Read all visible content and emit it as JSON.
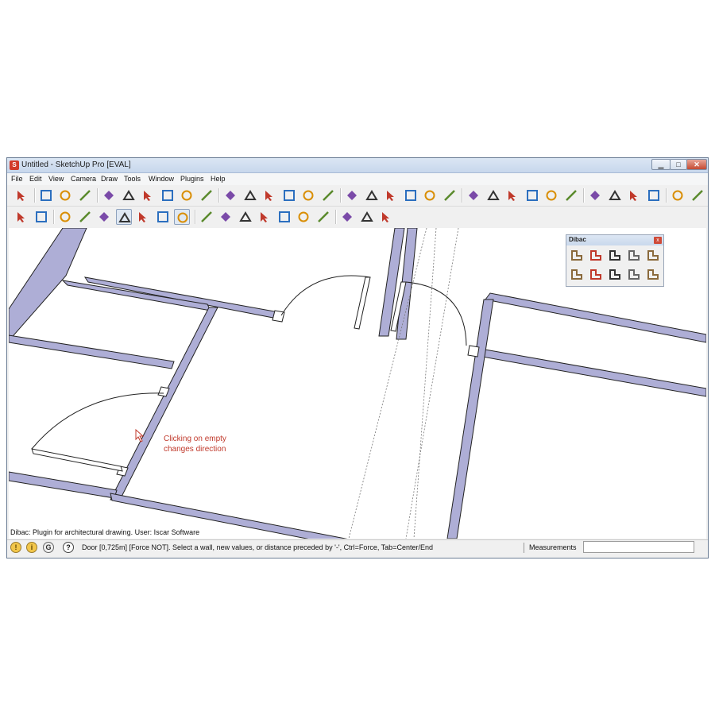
{
  "window": {
    "title": "Untitled - SketchUp Pro [EVAL]",
    "app_icon_letter": "S",
    "minimize_glyph": "▁",
    "maximize_glyph": "□",
    "close_glyph": "✕"
  },
  "menu": [
    "File",
    "Edit",
    "View",
    "Camera",
    "Draw",
    "Tools",
    "Window",
    "Plugins",
    "Help"
  ],
  "toolbar1": [
    "select",
    "make-component",
    "paint-bucket",
    "eraser",
    "rectangle",
    "line",
    "circle",
    "arc",
    "polygon",
    "freehand",
    "move",
    "push-pull",
    "rotate",
    "follow-me",
    "scale",
    "offset",
    "tape-measure",
    "dimension",
    "protractor",
    "text",
    "axes",
    "3d-text",
    "orbit",
    "pan",
    "zoom",
    "zoom-window",
    "zoom-extents",
    "previous-view",
    "position-camera",
    "look-around",
    "walk",
    "section-plane",
    "sandbox-1",
    "sandbox-2",
    "sandbox-3"
  ],
  "toolbar2": [
    "iso-view",
    "top-view",
    "xray",
    "back-edges",
    "wireframe",
    "hidden-line",
    "shaded",
    "shaded-textures",
    "monochrome",
    "iso",
    "top",
    "front",
    "right",
    "back",
    "left",
    "bottom",
    "door-tool",
    "window-tool",
    "plugin-tool"
  ],
  "dibac": {
    "title": "Dibac",
    "close_glyph": "x",
    "tools": [
      "wall-tool",
      "stairs-tool",
      "extend-wall-tool",
      "door-tool",
      "window-tool",
      "dimension-tool",
      "stair-steps-tool",
      "railing-tool",
      "furniture-tool",
      "settings-tool"
    ]
  },
  "annotation": {
    "line1": "Clicking on empty",
    "line2": "changes direction"
  },
  "plugin_line": "Dibac: Plugin for architectural drawing. User: Iscar Software",
  "status": {
    "text": "Door [0,725m] [Force NOT]. Select a wall, new values, or distance preceded by '-', Ctrl=Force, Tab=Center/End",
    "measurements_label": "Measurements",
    "measurements_value": ""
  },
  "colors": {
    "wall_fill": "#aeaed6",
    "wall_stroke": "#222222",
    "annotation": "#c0392b"
  }
}
